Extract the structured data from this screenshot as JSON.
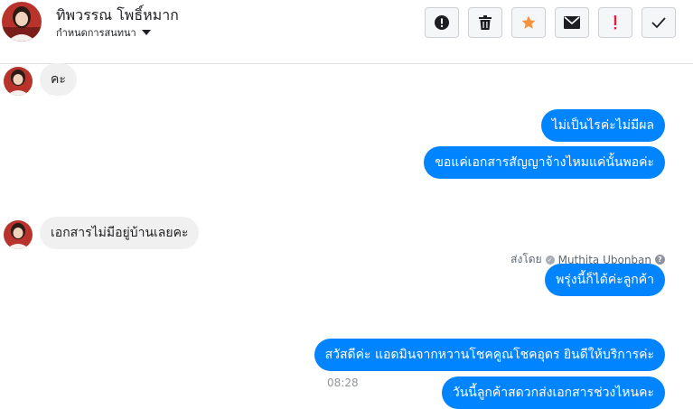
{
  "header": {
    "contact_name": "ทิพวรรณ โพธิ์หมาก",
    "manage_label": "กำหนดการสนทนา",
    "toolbar": [
      {
        "icon": "alert-circle-icon",
        "label": "รายงานสแปม"
      },
      {
        "icon": "trash-icon",
        "label": "ลบ"
      },
      {
        "icon": "star-icon",
        "label": "ติดดาว"
      },
      {
        "icon": "envelope-icon",
        "label": "ทำเครื่องหมายว่ายังไม่ได้อ่าน"
      },
      {
        "icon": "exclamation-icon",
        "label": "ติดตามผล"
      },
      {
        "icon": "check-icon",
        "label": "เสร็จสิ้น"
      }
    ]
  },
  "messages": [
    {
      "direction": "in",
      "text": "คะ"
    },
    {
      "direction": "out",
      "text": "ไม่เป็นไรค่ะไม่มีผล"
    },
    {
      "direction": "out",
      "text": "ขอแค่เอกสารสัญญาจ้างไหมแค่นั้นพอค่ะ"
    },
    {
      "direction": "in",
      "text": "เอกสารไม่มีอยู่บ้านเลยคะ"
    },
    {
      "direction": "out",
      "text": "พรุ่งนี้ก็ได้ค่ะลูกค้า"
    },
    {
      "direction": "out",
      "text": "สวัสดีค่ะ แอดมินจากหวานโชคคูณโชคอุดร ยินดีให้บริการค่ะ"
    },
    {
      "direction": "out",
      "text": "วันนี้ลูกค้าสดวกส่งเอกสารช่วงไหนคะ"
    }
  ],
  "sent_by": {
    "prefix": "ส่งโดย",
    "name": "Muthita Ubonban"
  },
  "timestamp": "08:28",
  "colors": {
    "outgoing": "#0084ff",
    "incoming": "#f1f0f0",
    "star": "#f7923b",
    "exclamation": "#e41e3f"
  }
}
